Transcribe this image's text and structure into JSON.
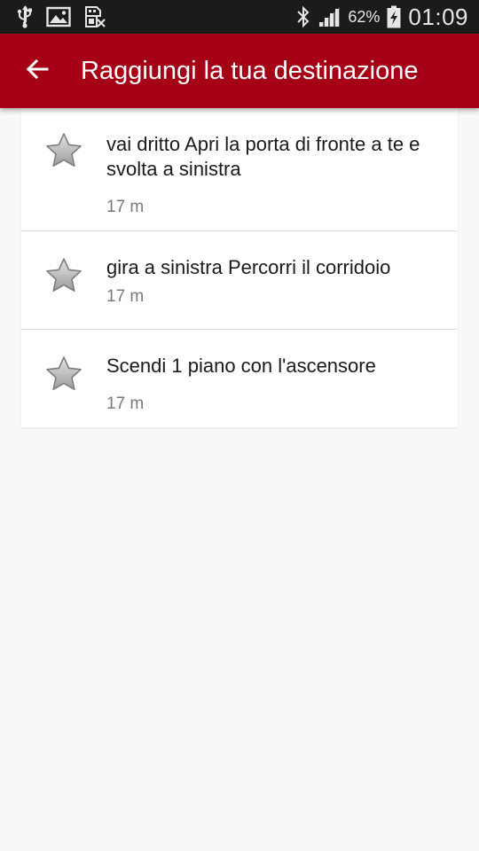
{
  "status_bar": {
    "icons_left": [
      "usb-icon",
      "image-icon",
      "sim-off-icon"
    ],
    "icons_right": [
      "bluetooth-icon",
      "signal-icon"
    ],
    "battery_percent": "62%",
    "battery_icon": "battery-charging-icon",
    "time": "01:09"
  },
  "app_bar": {
    "back_icon": "arrow-back-icon",
    "title": "Raggiungi la tua destinazione",
    "background_color": "#a50016"
  },
  "steps": [
    {
      "icon": "star-icon",
      "text": "vai dritto Apri la porta di fronte a te e svolta a sinistra",
      "distance": "17 m"
    },
    {
      "icon": "star-icon",
      "text": "gira a sinistra Percorri il corridoio",
      "distance": "17 m"
    },
    {
      "icon": "star-icon",
      "text": "Scendi 1 piano con l'ascensore",
      "distance": "17 m"
    }
  ]
}
